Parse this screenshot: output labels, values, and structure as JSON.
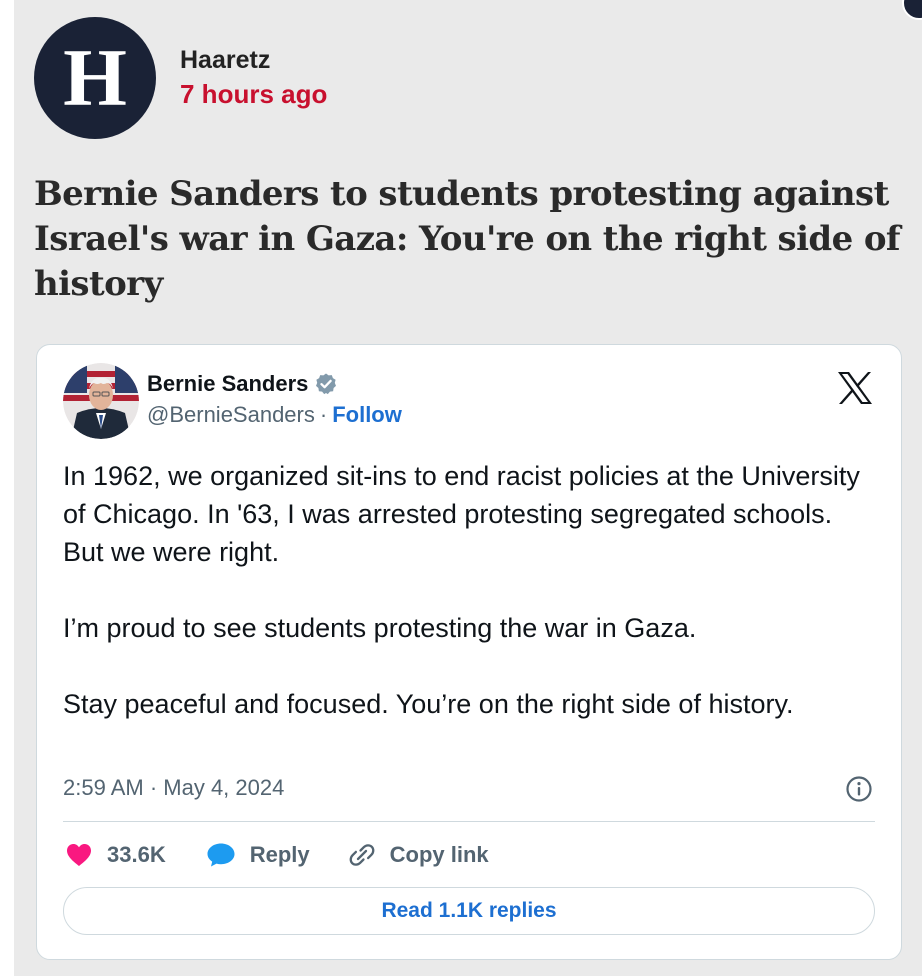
{
  "publisher": {
    "logo_letter": "H",
    "name": "Haaretz",
    "time_ago": "7 hours ago"
  },
  "headline": "Bernie Sanders to students protesting against Israel's war in Gaza: You're on the right side of history",
  "tweet": {
    "author_name": "Bernie Sanders",
    "handle": "@BernieSanders",
    "separator": "·",
    "follow_label": "Follow",
    "text_paragraphs": [
      "In 1962, we organized sit-ins to end racist policies at the University of Chicago. In '63, I was arrested protesting segregated schools. But we were right.",
      "I’m proud to see students protesting the war in Gaza.",
      "Stay peaceful and focused. You’re on the right side of history."
    ],
    "timestamp": "2:59 AM · May 4, 2024",
    "likes_count": "33.6K",
    "reply_label": "Reply",
    "copy_link_label": "Copy link",
    "read_replies_label": "Read 1.1K replies"
  },
  "icons": {
    "publisher_logo": "haaretz-h-logo",
    "verified": "verified-badge-icon",
    "platform": "x-logo-icon",
    "info": "info-icon",
    "like": "heart-icon",
    "reply": "speech-bubble-icon",
    "copy_link": "link-icon"
  },
  "colors": {
    "time_red": "#c8102e",
    "link_blue": "#1d6fd1",
    "like_pink": "#f91880",
    "reply_blue": "#1d9bf0",
    "logo_navy": "#1a2236",
    "page_bg": "#eaeaea"
  }
}
